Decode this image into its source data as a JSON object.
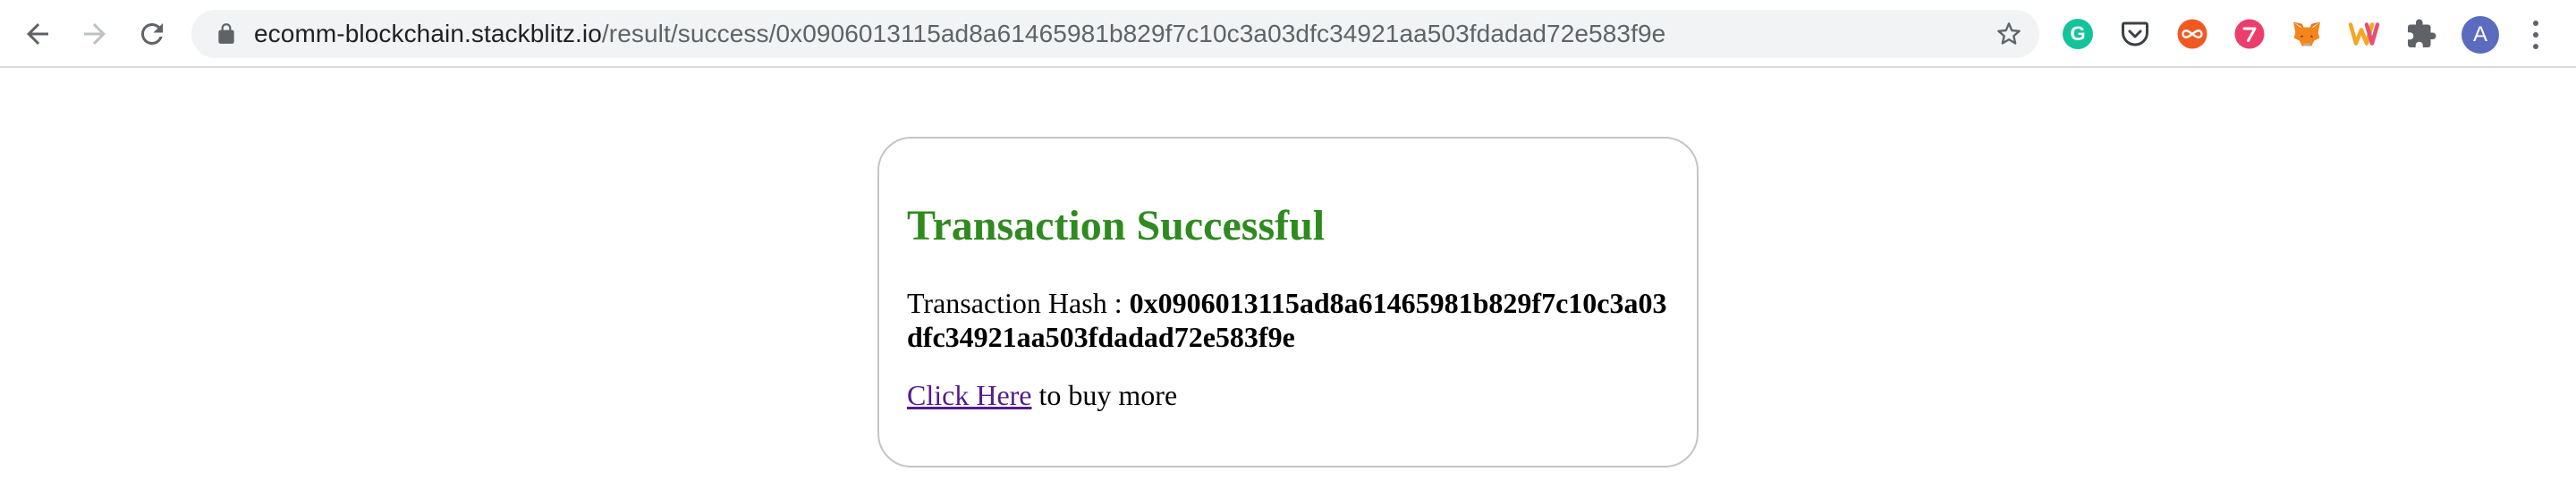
{
  "browser": {
    "url_host": "ecomm-blockchain.stackblitz.io",
    "url_path": "/result/success/0x0906013115ad8a61465981b829f7c10c3a03dfc34921aa503fdadad72e583f9e",
    "avatar_initial": "A",
    "grammarly_letter": "G",
    "icons": {
      "back": "arrow-left-icon",
      "forward": "arrow-right-icon",
      "reload": "reload-icon",
      "lock": "lock-icon",
      "bookmark": "star-icon",
      "extensions": [
        "grammarly-icon",
        "pocket-icon",
        "infinity-icon",
        "ext-red-icon",
        "metamask-icon",
        "wallet-w-icon",
        "puzzle-icon"
      ],
      "menu": "kebab-menu-icon"
    }
  },
  "page": {
    "title": "Transaction Successful",
    "title_color": "#2f8a1f",
    "hash_label": "Transaction Hash : ",
    "hash_value": "0x0906013115ad8a61465981b829f7c10c3a03dfc34921aa503fdadad72e583f9e",
    "link_text": "Click Here",
    "link_suffix": " to buy more"
  }
}
